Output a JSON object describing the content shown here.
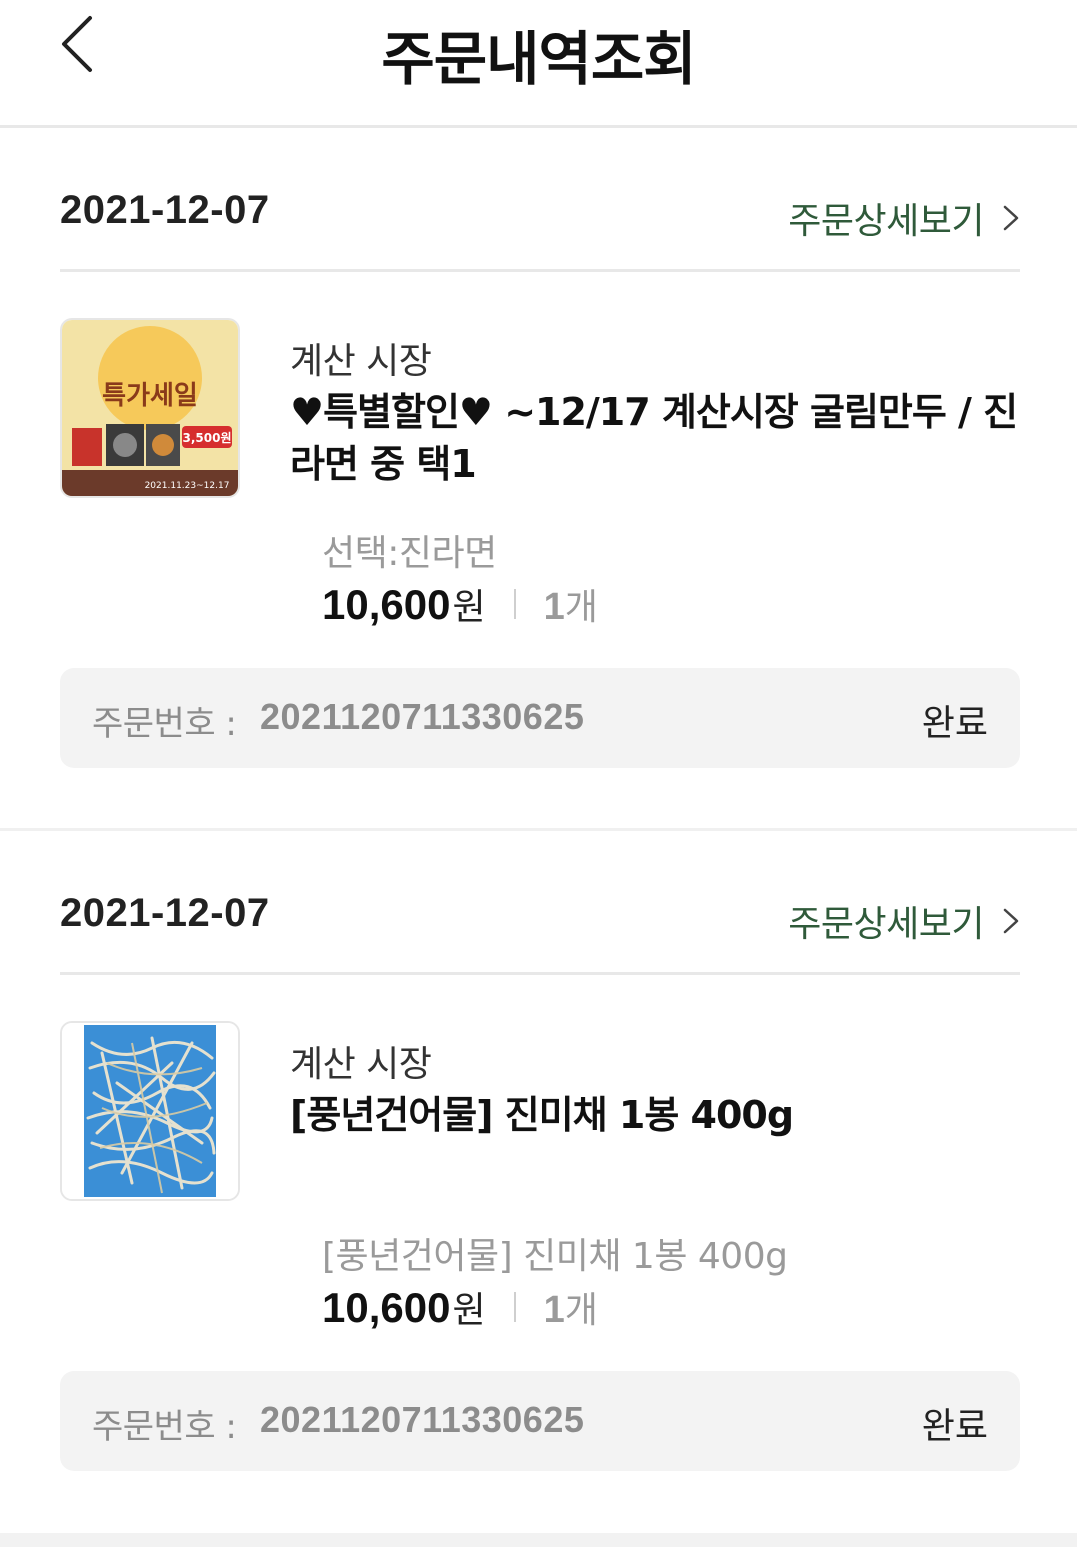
{
  "header": {
    "title": "주문내역조회",
    "back_icon": "chevron-left-icon"
  },
  "orders": [
    {
      "date": "2021-12-07",
      "detail_label": "주문상세보기",
      "market": "계산 시장",
      "product_name": "♥특별할인♥ ~12/17 계산시장 굴림만두 / 진라면 중 택1",
      "option": "선택:진라면",
      "price": "10,600",
      "currency": "원",
      "qty": "1",
      "qty_unit": "개",
      "order_no_label": "주문번호 :",
      "order_no": "2021120711330625",
      "status": "완료",
      "thumb_text": {
        "line1": "특가세일",
        "price": "3,500원",
        "dates": "2021.11.23~12.17"
      }
    },
    {
      "date": "2021-12-07",
      "detail_label": "주문상세보기",
      "market": "계산 시장",
      "product_name": "[풍년건어물] 진미채 1봉 400g",
      "option": "[풍년건어물] 진미채 1봉 400g",
      "price": "10,600",
      "currency": "원",
      "qty": "1",
      "qty_unit": "개",
      "order_no_label": "주문번호 :",
      "order_no": "2021120711330625",
      "status": "완료"
    }
  ],
  "colors": {
    "accent_link": "#2f5a3a",
    "muted": "#9a9a9a",
    "bar_bg": "#f3f3f3"
  }
}
